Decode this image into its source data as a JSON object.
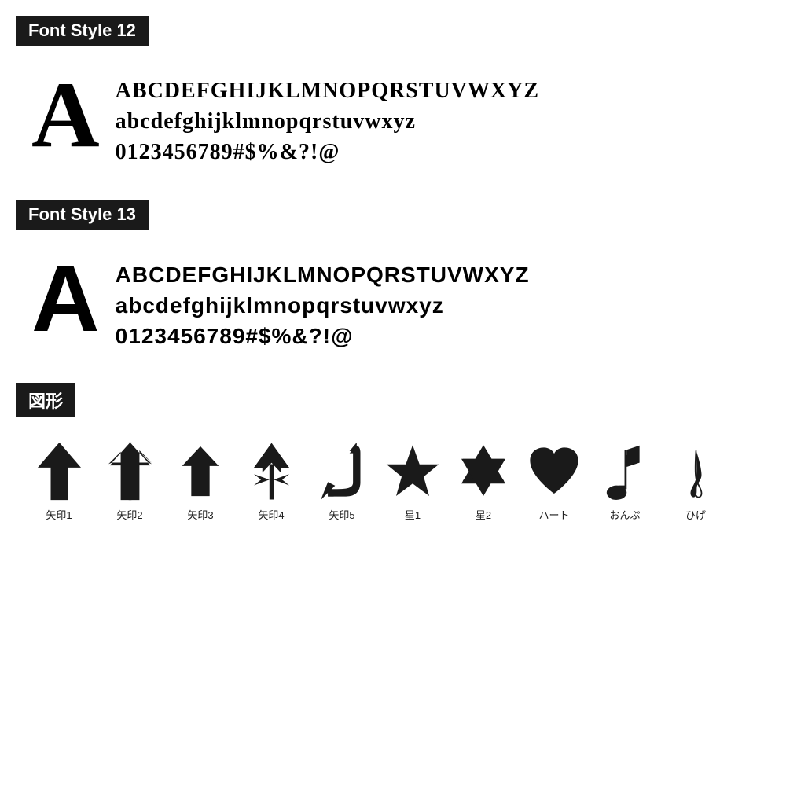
{
  "sections": [
    {
      "id": "font-style-12",
      "label": "Font Style 12",
      "big_letter": "A",
      "lines": [
        "ABCDEFGHIJKLMNOPQRSTUVWXYZ",
        "abcdefghijklmnopqrstuvwxyz",
        "0123456789#$%&?!@"
      ],
      "style_class": "font-style-12"
    },
    {
      "id": "font-style-13",
      "label": "Font Style 13",
      "big_letter": "A",
      "lines": [
        "ABCDEFGHIJKLMNOPQRSTUVWXYZ",
        "abcdefghijklmnopqrstuvwxyz",
        "0123456789#$%&?!@"
      ],
      "style_class": "font-style-13"
    }
  ],
  "shapes_section": {
    "label": "図形",
    "items": [
      {
        "name": "矢印1",
        "icon": "arrow1"
      },
      {
        "name": "矢印2",
        "icon": "arrow2"
      },
      {
        "name": "矢印3",
        "icon": "arrow3"
      },
      {
        "name": "矢印4",
        "icon": "arrow4"
      },
      {
        "name": "矢印5",
        "icon": "arrow5"
      },
      {
        "name": "星1",
        "icon": "star1"
      },
      {
        "name": "星2",
        "icon": "star2"
      },
      {
        "name": "ハート",
        "icon": "heart"
      },
      {
        "name": "おんぷ",
        "icon": "music"
      },
      {
        "name": "ひげ",
        "icon": "mustache"
      }
    ]
  }
}
